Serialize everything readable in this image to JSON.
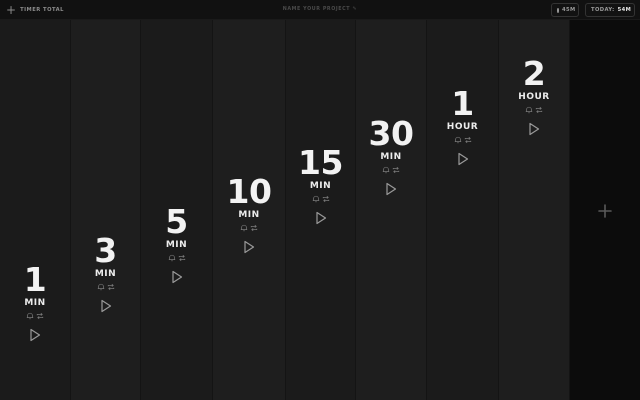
{
  "header": {
    "app_title": "TIMER TOTAL",
    "project_placeholder": "NAME YOUR PROJECT",
    "timer_chip": "45M",
    "today_label": "TODAY:",
    "today_value": "54M"
  },
  "timers": [
    {
      "value": "1",
      "unit": "MIN"
    },
    {
      "value": "3",
      "unit": "MIN"
    },
    {
      "value": "5",
      "unit": "MIN"
    },
    {
      "value": "10",
      "unit": "MIN"
    },
    {
      "value": "15",
      "unit": "MIN"
    },
    {
      "value": "30",
      "unit": "MIN"
    },
    {
      "value": "1",
      "unit": "HOUR"
    },
    {
      "value": "2",
      "unit": "HOUR"
    }
  ],
  "icons": {
    "add_timer_header": "plus-icon",
    "edit_project": "pencil-icon",
    "timer_chip": "clock-icon",
    "bell": "bell-icon",
    "repeat": "repeat-icon",
    "play": "play-icon",
    "add_timer": "plus-icon"
  }
}
